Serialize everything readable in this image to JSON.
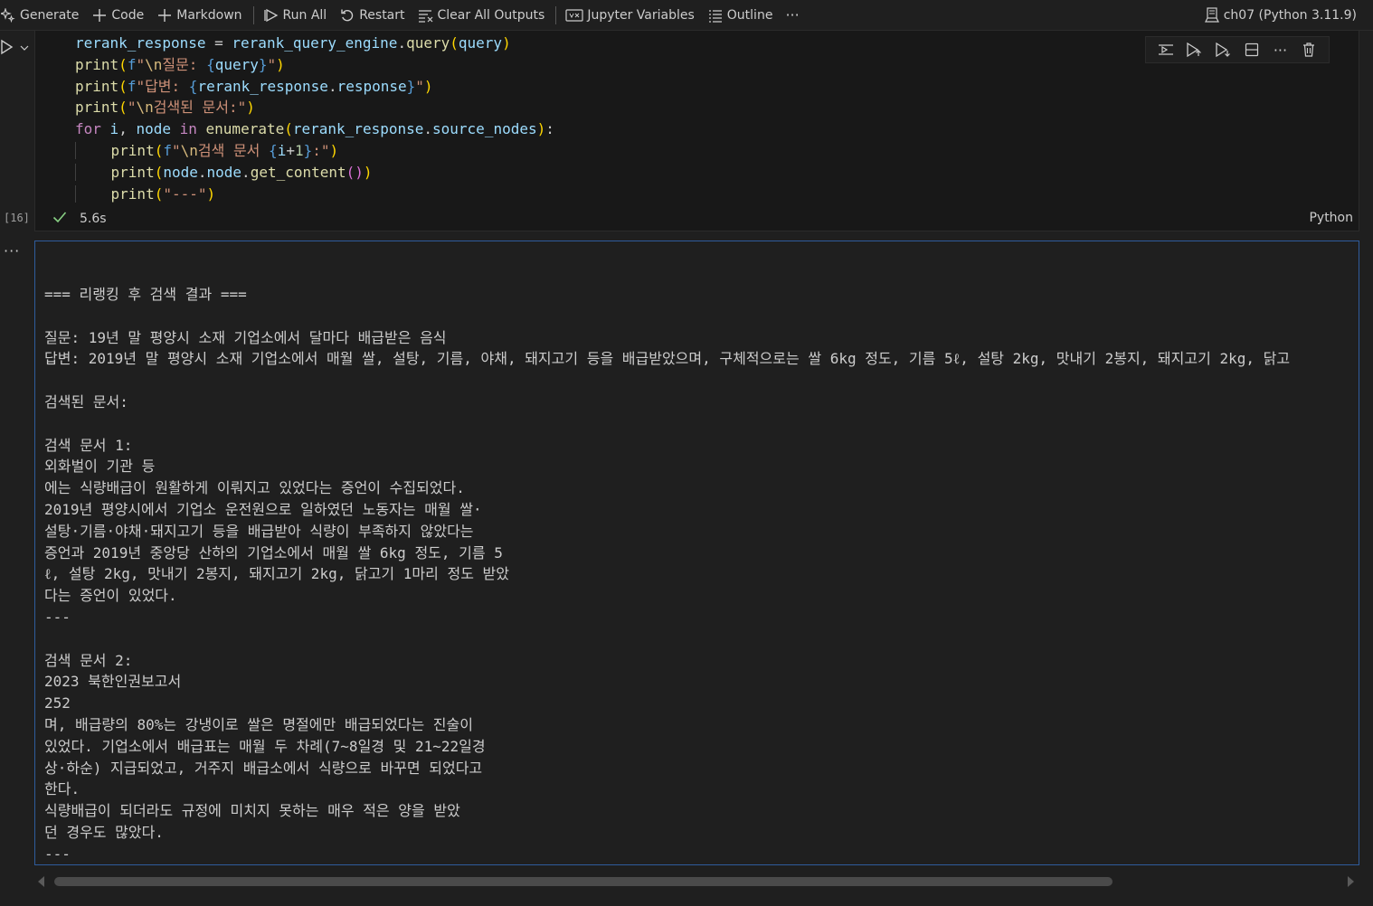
{
  "toolbar": {
    "generate": "Generate",
    "code": "Code",
    "markdown": "Markdown",
    "run_all": "Run All",
    "restart": "Restart",
    "clear_all_outputs": "Clear All Outputs",
    "jupyter_variables": "Jupyter Variables",
    "outline": "Outline",
    "more": "···",
    "kernel": "ch07 (Python 3.11.9)"
  },
  "cell": {
    "execution_count": "[16]",
    "duration": "5.6s",
    "language": "Python",
    "code_lines": [
      "rerank_response = rerank_query_engine.query(query)",
      "print(f\"\\n질문: {query}\")",
      "print(f\"답변: {rerank_response.response}\")",
      "print(\"\\n검색된 문서:\")",
      "for i, node in enumerate(rerank_response.source_nodes):",
      "    print(f\"\\n검색 문서 {i+1}:\")",
      "    print(node.node.get_content())",
      "    print(\"---\")"
    ]
  },
  "output": {
    "more_icon": "···",
    "lines": [
      "=== 리랭킹 후 검색 결과 ===",
      "",
      "질문: 19년 말 평양시 소재 기업소에서 달마다 배급받은 음식",
      "답변: 2019년 말 평양시 소재 기업소에서 매월 쌀, 설탕, 기름, 야채, 돼지고기 등을 배급받았으며, 구체적으로는 쌀 6kg 정도, 기름 5ℓ, 설탕 2kg, 맛내기 2봉지, 돼지고기 2kg, 닭고",
      "",
      "검색된 문서:",
      "",
      "검색 문서 1:",
      "외화벌이 기관 등",
      "에는 식량배급이 원활하게 이뤄지고 있었다는 증언이 수집되었다.",
      "2019년 평양시에서 기업소 운전원으로 일하였던 노동자는 매월 쌀·",
      "설탕·기름·야채·돼지고기 등을 배급받아 식량이 부족하지 않았다는",
      "증언과 2019년 중앙당 산하의 기업소에서 매월 쌀 6kg 정도, 기름 5",
      "ℓ, 설탕 2kg, 맛내기 2봉지, 돼지고기 2kg, 닭고기 1마리 정도 받았",
      "다는 증언이 있었다.",
      "---",
      "",
      "검색 문서 2:",
      "2023 북한인권보고서",
      "252",
      "며, 배급량의 80%는 강냉이로 쌀은 명절에만 배급되었다는 진술이",
      "있었다. 기업소에서 배급표는 매월 두 차례(7~8일경 및 21~22일경",
      "상·하순) 지급되었고, 거주지 배급소에서 식량으로 바꾸면 되었다고",
      "한다.",
      "식량배급이 되더라도 규정에 미치지 못하는 매우 적은 양을 받았",
      "던 경우도 많았다.",
      "---"
    ]
  },
  "icons": {
    "generate": "sparkle-icon",
    "code": "plus-icon",
    "markdown": "plus-icon",
    "run_all": "run-all-icon",
    "restart": "restart-icon",
    "clear": "clear-outputs-icon",
    "variables": "variables-icon",
    "outline": "outline-icon",
    "kernel": "kernel-icon"
  },
  "colors": {
    "keyword": "#569cd6",
    "control": "#c586c0",
    "function": "#dcdcaa",
    "variable": "#9cdcfe",
    "string": "#ce9178",
    "output_border": "#2f5c9c",
    "success": "#89d185"
  }
}
